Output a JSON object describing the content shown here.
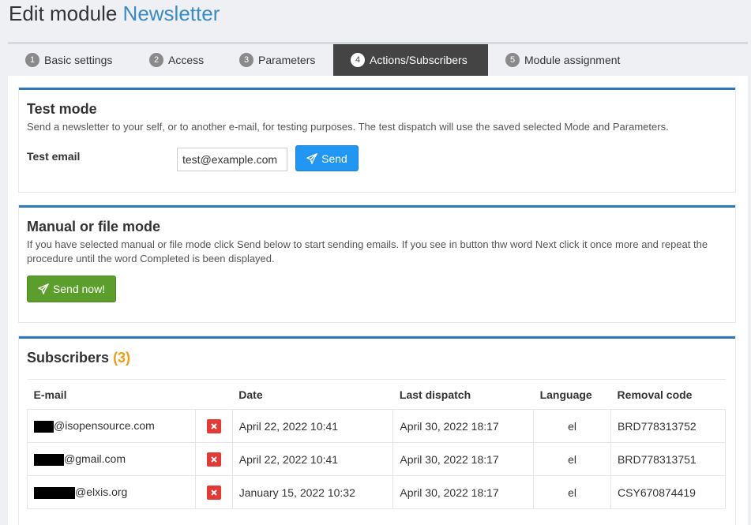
{
  "page": {
    "title_prefix": "Edit module",
    "title_module": "Newsletter"
  },
  "tabs": [
    {
      "num": "1",
      "label": "Basic settings"
    },
    {
      "num": "2",
      "label": "Access"
    },
    {
      "num": "3",
      "label": "Parameters"
    },
    {
      "num": "4",
      "label": "Actions/Subscribers"
    },
    {
      "num": "5",
      "label": "Module assignment"
    }
  ],
  "test_mode": {
    "title": "Test mode",
    "description": "Send a newsletter to your self, or to another e-mail, for testing purposes. The test dispatch will use the saved selected Mode and Parameters.",
    "email_label": "Test email",
    "email_value": "test@example.com",
    "send_label": "Send"
  },
  "manual_mode": {
    "title": "Manual or file mode",
    "description": "If you have selected manual or file mode click Send below to start sending emails. If you see in button thw word Next click it once more and repeat the procedure until the word Completed is been displayed.",
    "send_now_label": "Send now!"
  },
  "subscribers": {
    "title": "Subscribers",
    "count": "(3)",
    "columns": [
      "E-mail",
      "Date",
      "Last dispatch",
      "Language",
      "Removal code"
    ],
    "rows": [
      {
        "email_domain": "@isopensource.com",
        "date": "April 22, 2022 10:41",
        "last_dispatch": "April 30, 2022 18:17",
        "language": "el",
        "removal_code": "BRD778313752"
      },
      {
        "email_domain": "@gmail.com",
        "date": "April 22, 2022 10:41",
        "last_dispatch": "April 30, 2022 18:17",
        "language": "el",
        "removal_code": "BRD778313751"
      },
      {
        "email_domain": "@elxis.org",
        "date": "January 15, 2022 10:32",
        "last_dispatch": "April 30, 2022 18:17",
        "language": "el",
        "removal_code": "CSY670874419"
      }
    ]
  },
  "colors": {
    "accent": "#3b8bc4",
    "panel_border": "#2f78b5",
    "send_button": "#2196f3",
    "send_now_button": "#5b9e2b",
    "delete_icon": "#e53935",
    "count": "#f39c12"
  }
}
